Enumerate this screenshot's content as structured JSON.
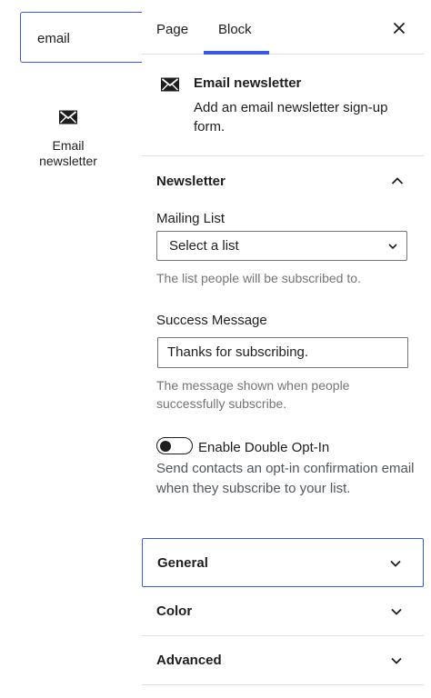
{
  "inserter": {
    "search_value": "email",
    "result_label": "Email newsletter",
    "result_icon": "envelope-icon"
  },
  "sidebar": {
    "tabs": [
      {
        "label": "Page",
        "active": false
      },
      {
        "label": "Block",
        "active": true
      }
    ],
    "close_icon": "close-icon",
    "accent_color": "#3858e9",
    "block": {
      "icon": "envelope-icon",
      "title": "Email newsletter",
      "description": "Add an email newsletter sign-up form."
    },
    "newsletter_panel": {
      "title": "Newsletter",
      "expanded": true,
      "mailing_list": {
        "label": "Mailing List",
        "selected": "Select a list",
        "help": "The list people will be subscribed to."
      },
      "success_message": {
        "label": "Success Message",
        "value": "Thanks for subscribing.",
        "help": "The message shown when people successfully subscribe."
      },
      "double_opt_in": {
        "label": "Enable Double Opt-In",
        "enabled": false,
        "help": "Send contacts an opt-in confirmation email when they subscribe to your list."
      }
    },
    "panels": [
      {
        "title": "General",
        "expanded": false,
        "focused": true
      },
      {
        "title": "Color",
        "expanded": false
      },
      {
        "title": "Advanced",
        "expanded": false
      }
    ]
  }
}
